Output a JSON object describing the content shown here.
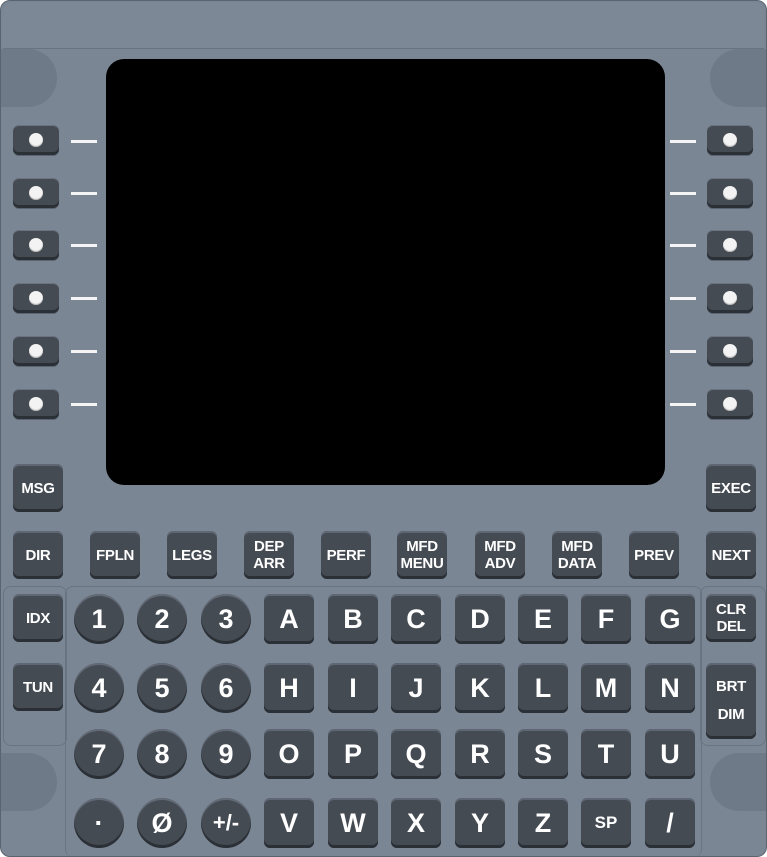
{
  "colors": {
    "bezel": "#7b8695",
    "key": "#454b53",
    "screen": "#000000",
    "legend": "#ffffff"
  },
  "line_select_keys": {
    "left": [
      {
        "icon": "lsk-dot-icon"
      },
      {
        "icon": "lsk-dot-icon"
      },
      {
        "icon": "lsk-dot-icon"
      },
      {
        "icon": "lsk-dot-icon"
      },
      {
        "icon": "lsk-dot-icon"
      },
      {
        "icon": "lsk-dot-icon"
      }
    ],
    "right": [
      {
        "icon": "lsk-dot-icon"
      },
      {
        "icon": "lsk-dot-icon"
      },
      {
        "icon": "lsk-dot-icon"
      },
      {
        "icon": "lsk-dot-icon"
      },
      {
        "icon": "lsk-dot-icon"
      },
      {
        "icon": "lsk-dot-icon"
      }
    ]
  },
  "function_keys": {
    "msg": "MSG",
    "exec": "EXEC",
    "dir": "DIR",
    "fpln": "FPLN",
    "legs": "LEGS",
    "dep_arr": [
      "DEP",
      "ARR"
    ],
    "perf": "PERF",
    "mfd_menu": [
      "MFD",
      "MENU"
    ],
    "mfd_adv": [
      "MFD",
      "ADV"
    ],
    "mfd_data": [
      "MFD",
      "DATA"
    ],
    "prev": "PREV",
    "next": "NEXT",
    "idx": "IDX",
    "tun": "TUN",
    "clr_del": [
      "CLR",
      "DEL"
    ],
    "brt_dim": [
      "BRT",
      "DIM"
    ]
  },
  "numeric_keys": {
    "row1": [
      "1",
      "2",
      "3"
    ],
    "row2": [
      "4",
      "5",
      "6"
    ],
    "row3": [
      "7",
      "8",
      "9"
    ],
    "row4": [
      "·",
      "Ø",
      "+/-"
    ]
  },
  "alpha_keys": {
    "row1": [
      "A",
      "B",
      "C",
      "D",
      "E",
      "F",
      "G"
    ],
    "row2": [
      "H",
      "I",
      "J",
      "K",
      "L",
      "M",
      "N"
    ],
    "row3": [
      "O",
      "P",
      "Q",
      "R",
      "S",
      "T",
      "U"
    ],
    "row4": [
      "V",
      "W",
      "X",
      "Y",
      "Z",
      "SP",
      "/"
    ]
  }
}
